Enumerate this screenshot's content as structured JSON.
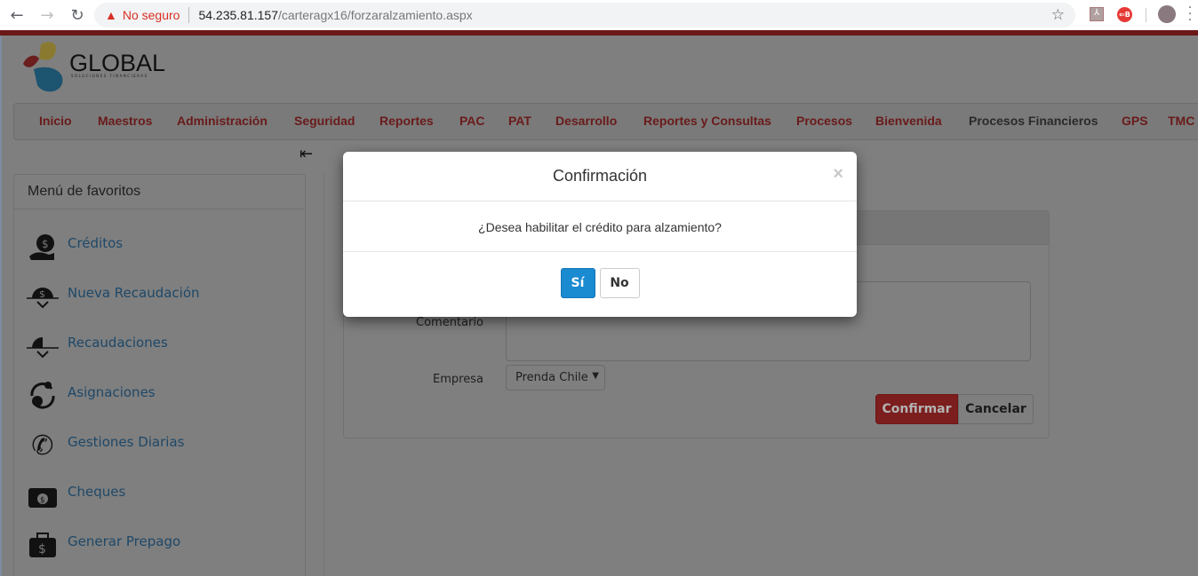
{
  "browser": {
    "security_label": "No seguro",
    "url_host": "54.235.81.157",
    "url_path": "/carteragx16/forzaralzamiento.aspx"
  },
  "logo": {
    "name": "GLOBAL",
    "tagline": "SOLUCIONES FINANCIERAS"
  },
  "nav": {
    "items": [
      "Inicio",
      "Maestros",
      "Administración",
      "Seguridad",
      "Reportes",
      "PAC",
      "PAT",
      "Desarrollo",
      "Reportes y Consultas",
      "Procesos",
      "Bienvenida",
      "Procesos Financieros",
      "GPS",
      "TMC"
    ]
  },
  "sidebar": {
    "title": "Menú de favoritos",
    "items": [
      {
        "label": "Créditos",
        "icon": "hand-coin-icon"
      },
      {
        "label": "Nueva Recaudación",
        "icon": "coin-down-icon"
      },
      {
        "label": "Recaudaciones",
        "icon": "coin-down-icon"
      },
      {
        "label": "Asignaciones",
        "icon": "cycle-coin-icon"
      },
      {
        "label": "Gestiones Diarias",
        "icon": "phone-icon"
      },
      {
        "label": "Cheques",
        "icon": "wallet-icon"
      },
      {
        "label": "Generar Prepago",
        "icon": "briefcase-dollar-icon"
      }
    ]
  },
  "form": {
    "comment_label": "Comentario",
    "comment_value": "",
    "company_label": "Empresa",
    "company_value": "Prenda Chile",
    "confirm_label": "Confirmar",
    "cancel_label": "Cancelar"
  },
  "modal": {
    "title": "Confirmación",
    "close": "×",
    "message": "¿Desea habilitar el crédito para alzamiento?",
    "yes_label": "Sí",
    "no_label": "No"
  },
  "colors": {
    "brand_red": "#6b1818",
    "link_blue": "#1e4868",
    "primary": "#1a8ad1"
  }
}
